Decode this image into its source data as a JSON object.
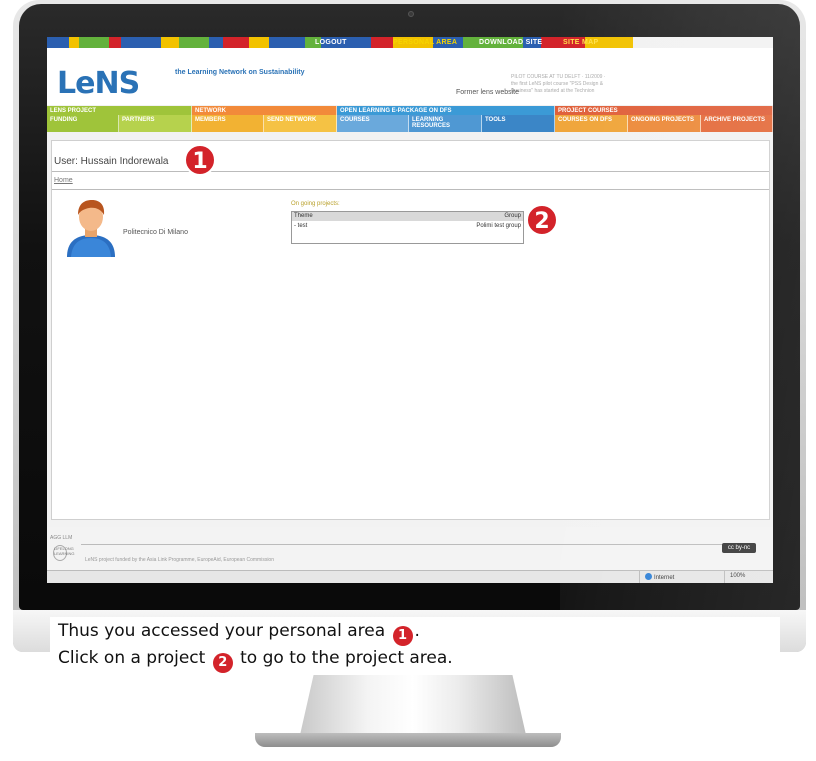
{
  "colors": {
    "brand_blue": "#2a72b6",
    "badge_red": "#d3232a",
    "bar_segments": [
      "#2b5fb0",
      "#f2c200",
      "#63b23c",
      "#d3232a",
      "#2b5fb0",
      "#f2c200",
      "#63b23c",
      "#2b5fb0",
      "#d3232a",
      "#f2c200",
      "#2b5fb0",
      "#63b23c",
      "#2b5fb0",
      "#d3232a",
      "#f2c200",
      "#2b5fb0",
      "#63b23c",
      "#2b5fb0",
      "#d3232a",
      "#f2c200"
    ]
  },
  "topnav": {
    "logout": "LOGOUT",
    "personal_area": "PERSONAL AREA",
    "download_site": "DOWNLOAD SITE",
    "site_map": "SITE MAP"
  },
  "header": {
    "logo": "LeNS",
    "tagline": "the Learning Network on Sustainability",
    "former_site": "Former lens website",
    "news": "PILOT COURSE AT TU DELFT · 11/2009 · the first LeNS pilot course \"PSS Design & Business\" has started at the Technion"
  },
  "menu": {
    "groups": [
      {
        "label": "LENS PROJECT",
        "color": "#9fc43a"
      },
      {
        "label": "NETWORK",
        "color": "#f28a3a"
      },
      {
        "label": "OPEN LEARNING E-PACKAGE ON DFS",
        "color": "#3b9ad6"
      },
      {
        "label": "PROJECT COURSES",
        "color": "#e0603a"
      }
    ],
    "items": [
      {
        "label": "FUNDING",
        "color": "#9fc43a"
      },
      {
        "label": "PARTNERS",
        "color": "#b6d24d"
      },
      {
        "label": "MEMBERS",
        "color": "#f2b233"
      },
      {
        "label": "SEND NETWORK",
        "color": "#f5c244"
      },
      {
        "label": "COURSES",
        "color": "#6aa9dc"
      },
      {
        "label": "LEARNING RESOURCES",
        "color": "#4f98d3"
      },
      {
        "label": "TOOLS",
        "color": "#3b86c7"
      },
      {
        "label": "COURSES ON DFS",
        "color": "#f0a53a"
      },
      {
        "label": "ONGOING PROJECTS",
        "color": "#ec8a3a"
      },
      {
        "label": "ARCHIVE PROJECTS",
        "color": "#e46a3a"
      }
    ]
  },
  "content": {
    "user_line": "User: Hussain Indorewala",
    "home_link": "Home",
    "university": "Politecnico Di Milano",
    "ongoing_label": "On going projects:",
    "table": {
      "headers": [
        "Theme",
        "Group"
      ],
      "rows": [
        [
          "- test",
          "Polimi test group"
        ]
      ]
    }
  },
  "badges": {
    "one": "1",
    "two": "2"
  },
  "footer": {
    "small_top": "AGG LLM",
    "llp": "LIFELONG LEARNING",
    "small_bottom": "LeNS project funded by the Asia Link Programme, EuropeAid, European Commission",
    "cc": "cc by-nc"
  },
  "statusbar": {
    "zone": "Internet",
    "zoom": "100%"
  },
  "caption": {
    "line1_a": "Thus you accessed your personal area",
    "line1_num": "1",
    "line1_b": ".",
    "line2_a": "Click on a project",
    "line2_num": "2",
    "line2_b": "to go to the project area."
  }
}
